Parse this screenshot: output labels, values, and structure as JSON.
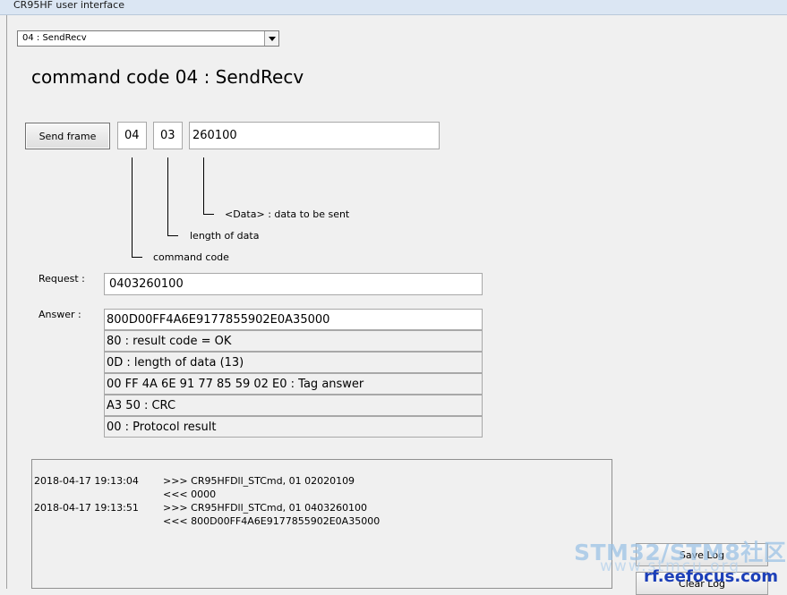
{
  "window": {
    "title": "CR95HF user interface"
  },
  "command_select": {
    "selected": "04 : SendRecv"
  },
  "heading": "command code 04 : SendRecv",
  "send_frame": {
    "button_label": "Send frame",
    "command_code": "04",
    "length": "03",
    "data": "260100"
  },
  "annotations": {
    "data": "<Data> : data to be sent",
    "length": "length of data",
    "command": "command code"
  },
  "request": {
    "label": "Request :",
    "value": "0403260100"
  },
  "answer": {
    "label": "Answer :",
    "rows": [
      "800D00FF4A6E9177855902E0A35000",
      "80 : result code = OK",
      "0D : length of data (13)",
      "00 FF 4A 6E 91 77 85 59 02 E0 : Tag answer",
      "A3 50 : CRC",
      "00 : Protocol result"
    ]
  },
  "log": {
    "entries": [
      {
        "time": "2018-04-17 19:13:04",
        "text": ">>> CR95HFDll_STCmd, 01 02020109"
      },
      {
        "time": "",
        "text": "<<< 0000"
      },
      {
        "time": "2018-04-17 19:13:51",
        "text": ">>> CR95HFDll_STCmd, 01 0403260100"
      },
      {
        "time": "",
        "text": "<<< 800D00FF4A6E9177855902E0A35000"
      }
    ],
    "save_label": "Save Log",
    "clear_label": "Clear Log"
  },
  "watermark": {
    "brand": "STM32/STM8社区",
    "site": "www.stmcu.org",
    "site2": "rf.eefocus.com"
  }
}
